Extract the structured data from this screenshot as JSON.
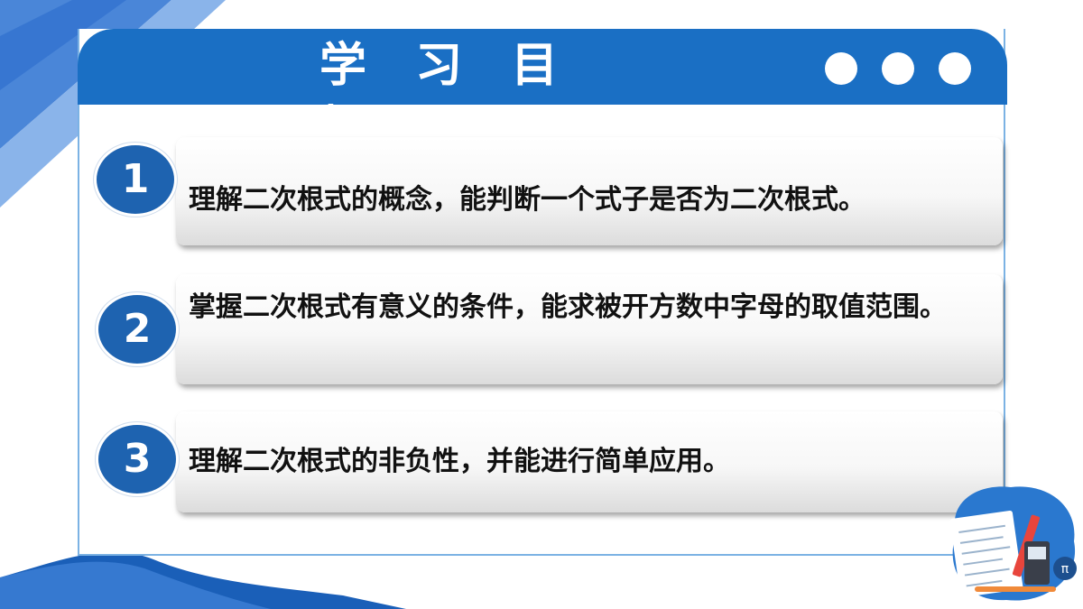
{
  "title": "学 习 目 标",
  "goals": [
    {
      "number": "1",
      "text": "理解二次根式的概念，能判断一个式子是否为二次根式。"
    },
    {
      "number": "2",
      "text": "掌握二次根式有意义的条件，能求被开方数中字母的取值范围。"
    },
    {
      "number": "3",
      "text": "理解二次根式的非负性，并能进行简单应用。"
    }
  ],
  "colors": {
    "primary": "#1a6fc4",
    "circle": "#1e63b0",
    "frame": "#7bb2e4"
  },
  "illustration_label": "π"
}
